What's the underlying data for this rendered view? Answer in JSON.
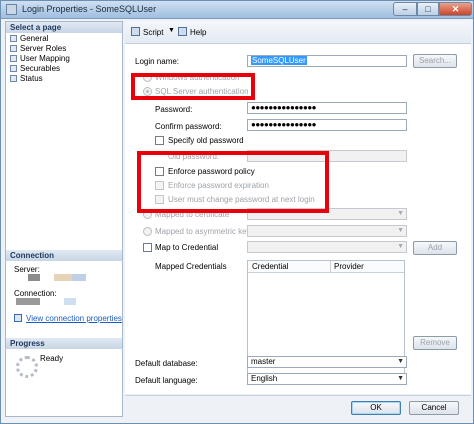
{
  "window": {
    "title": "Login Properties - SomeSQLUser",
    "minimize_glyph": "–",
    "maximize_glyph": "□",
    "close_glyph": "✕"
  },
  "left_pane": {
    "select_page_header": "Select a page",
    "pages": [
      {
        "label": "General",
        "icon": "page-icon"
      },
      {
        "label": "Server Roles",
        "icon": "page-icon"
      },
      {
        "label": "User Mapping",
        "icon": "page-icon"
      },
      {
        "label": "Securables",
        "icon": "page-icon"
      },
      {
        "label": "Status",
        "icon": "page-icon"
      }
    ],
    "connection_header": "Connection",
    "server_label": "Server:",
    "connection_label": "Connection:",
    "view_connection_link": "View connection properties",
    "progress_header": "Progress",
    "progress_status": "Ready"
  },
  "toolbar": {
    "script_label": "Script",
    "help_label": "Help"
  },
  "form": {
    "login_name_label": "Login name:",
    "login_name_value": "SomeSQLUser",
    "search_button": "Search...",
    "windows_auth_label": "Windows authentication",
    "sql_auth_label": "SQL Server authentication",
    "password_label": "Password:",
    "password_value": "●●●●●●●●●●●●●●●",
    "confirm_password_label": "Confirm password:",
    "confirm_password_value": "●●●●●●●●●●●●●●●",
    "specify_old_password_label": "Specify old password",
    "old_password_label": "Old password:",
    "enforce_policy_label": "Enforce password policy",
    "enforce_expiration_label": "Enforce password expiration",
    "must_change_label": "User must change password at next login",
    "mapped_certificate_label": "Mapped to certificate",
    "mapped_asym_key_label": "Mapped to asymmetric key",
    "map_credential_label": "Map to Credential",
    "add_button": "Add",
    "mapped_credentials_label": "Mapped Credentials",
    "grid_columns": [
      "Credential",
      "Provider"
    ],
    "remove_button": "Remove",
    "default_database_label": "Default database:",
    "default_database_value": "master",
    "default_language_label": "Default language:",
    "default_language_value": "English"
  },
  "buttons": {
    "ok": "OK",
    "cancel": "Cancel"
  },
  "colors": {
    "highlight_box": "#e8000b",
    "selection": "#3399ff",
    "link": "#1a5bbf"
  }
}
